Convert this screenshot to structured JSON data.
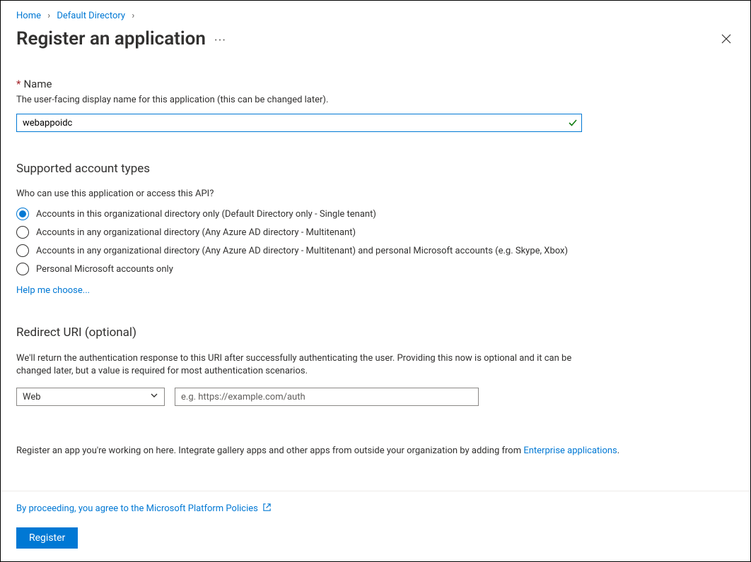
{
  "breadcrumb": {
    "home": "Home",
    "dir": "Default Directory"
  },
  "title": "Register an application",
  "name_section": {
    "label": "Name",
    "help": "The user-facing display name for this application (this can be changed later).",
    "value": "webappoidc"
  },
  "account_types": {
    "heading": "Supported account types",
    "question": "Who can use this application or access this API?",
    "options": {
      "o0": "Accounts in this organizational directory only (Default Directory only - Single tenant)",
      "o1": "Accounts in any organizational directory (Any Azure AD directory - Multitenant)",
      "o2": "Accounts in any organizational directory (Any Azure AD directory - Multitenant) and personal Microsoft accounts (e.g. Skype, Xbox)",
      "o3": "Personal Microsoft accounts only"
    },
    "help_link": "Help me choose..."
  },
  "redirect": {
    "heading": "Redirect URI (optional)",
    "desc": "We'll return the authentication response to this URI after successfully authenticating the user. Providing this now is optional and it can be changed later, but a value is required for most authentication scenarios.",
    "platform_value": "Web",
    "uri_placeholder": "e.g. https://example.com/auth"
  },
  "note": {
    "prefix": "Register an app you're working on here. Integrate gallery apps and other apps from outside your organization by adding from ",
    "link": "Enterprise applications",
    "suffix": "."
  },
  "footer": {
    "policy": "By proceeding, you agree to the Microsoft Platform Policies",
    "register": "Register"
  }
}
